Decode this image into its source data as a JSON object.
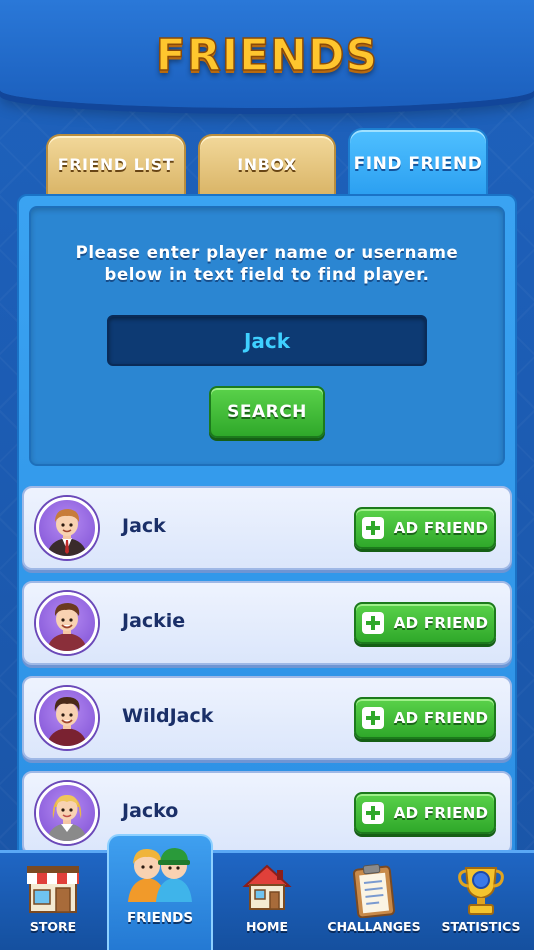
{
  "header": {
    "title": "FRIENDS"
  },
  "tabs": [
    {
      "label": "FRIEND LIST",
      "active": false
    },
    {
      "label": "INBOX",
      "active": false
    },
    {
      "label": "FIND FRIEND",
      "active": true
    }
  ],
  "search": {
    "instructions": "Please enter player name or username below in text field to find player.",
    "value": "Jack",
    "button_label": "SEARCH"
  },
  "results": [
    {
      "name": "Jack",
      "button_label": "AD FRIEND",
      "avatar": "man-suit-avatar"
    },
    {
      "name": "Jackie",
      "button_label": "AD FRIEND",
      "avatar": "man-brown-hair-avatar"
    },
    {
      "name": "WildJack",
      "button_label": "AD FRIEND",
      "avatar": "man-dark-hair-avatar"
    },
    {
      "name": "Jacko",
      "button_label": "AD FRIEND",
      "avatar": "woman-blonde-avatar"
    }
  ],
  "nav": [
    {
      "label": "STORE",
      "icon": "store-icon",
      "active": false
    },
    {
      "label": "FRIENDS",
      "icon": "friends-icon",
      "active": true
    },
    {
      "label": "HOME",
      "icon": "home-icon",
      "active": false
    },
    {
      "label": "CHALLANGES",
      "icon": "clipboard-icon",
      "active": false
    },
    {
      "label": "STATISTICS",
      "icon": "trophy-icon",
      "active": false
    }
  ],
  "colors": {
    "accent_blue": "#2c8fe3",
    "title_gold": "#ffc62e",
    "button_green": "#2fa82a",
    "input_bg": "#0d3a73",
    "input_text": "#3fd0ff"
  }
}
